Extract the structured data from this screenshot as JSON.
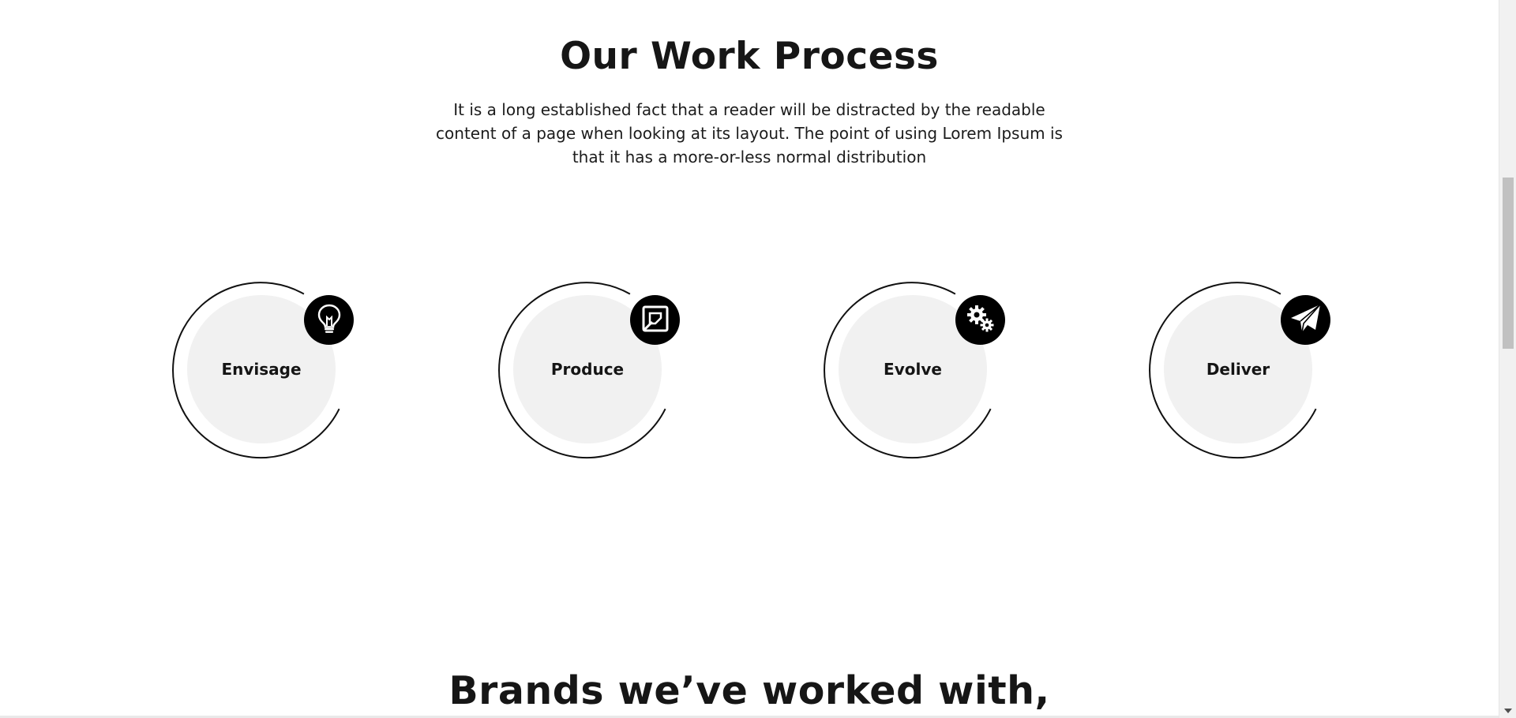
{
  "process": {
    "title": "Our Work Process",
    "description": "It is a long established fact that a reader will be distracted by the readable content of a page when looking at its layout. The point of using Lorem Ipsum is that it has a more-or-less normal distribution",
    "steps": [
      {
        "label": "Envisage",
        "icon": "lightbulb-icon"
      },
      {
        "label": "Produce",
        "icon": "edit-note-icon"
      },
      {
        "label": "Evolve",
        "icon": "gears-icon"
      },
      {
        "label": "Deliver",
        "icon": "paper-plane-icon"
      }
    ]
  },
  "brands": {
    "title": "Brands we’ve worked with,"
  },
  "colors": {
    "badge": "#000000",
    "circle_fill": "#f1f1f1",
    "ring": "#111111",
    "text": "#111111"
  }
}
